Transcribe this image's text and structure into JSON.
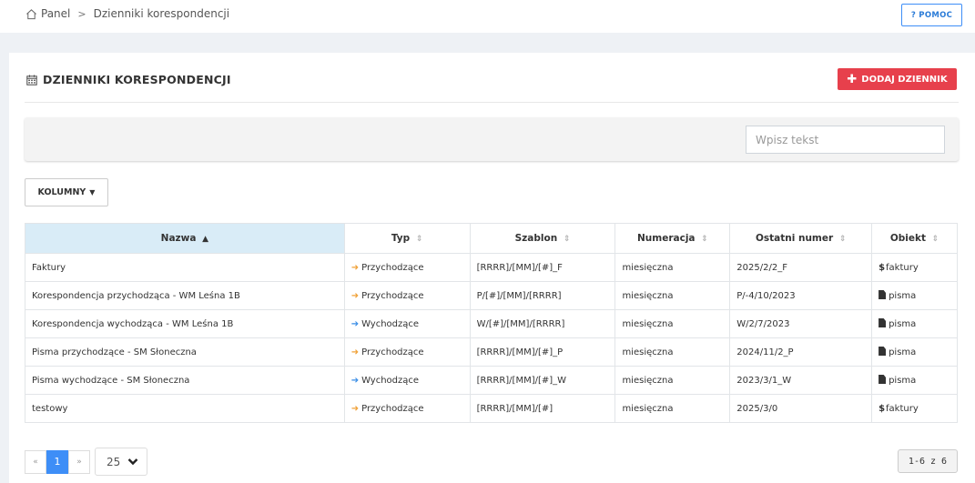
{
  "breadcrumb": {
    "home": "Panel",
    "current": "Dzienniki korespondencji"
  },
  "help_label": "? POMOC",
  "page_title": "DZIENNIKI KORESPONDENCJI",
  "add_label": "DODAJ DZIENNIK",
  "search": {
    "placeholder": "Wpisz tekst",
    "value": ""
  },
  "columns_button": "KOLUMNY",
  "table": {
    "headers": {
      "name": "Nazwa",
      "type": "Typ",
      "template": "Szablon",
      "numbering": "Numeracja",
      "last_number": "Ostatni numer",
      "object": "Obiekt"
    },
    "rows": [
      {
        "name": "Faktury",
        "type": "Przychodzące",
        "type_icon": "sign-in-icon",
        "template": "[RRRR]/[MM]/[#]_F",
        "numbering": "miesięczna",
        "last_number": "2025/2/2_F",
        "object": "faktury",
        "object_icon": "dollar-icon"
      },
      {
        "name": "Korespondencja przychodząca - WM Leśna 1B",
        "type": "Przychodzące",
        "type_icon": "sign-in-icon",
        "template": "P/[#]/[MM]/[RRRR]",
        "numbering": "miesięczna",
        "last_number": "P/-4/10/2023",
        "object": "pisma",
        "object_icon": "document-icon"
      },
      {
        "name": "Korespondencja wychodząca - WM Leśna 1B",
        "type": "Wychodzące",
        "type_icon": "sign-out-icon",
        "template": "W/[#]/[MM]/[RRRR]",
        "numbering": "miesięczna",
        "last_number": "W/2/7/2023",
        "object": "pisma",
        "object_icon": "document-icon"
      },
      {
        "name": "Pisma przychodzące - SM Słoneczna",
        "type": "Przychodzące",
        "type_icon": "sign-in-icon",
        "template": "[RRRR]/[MM]/[#]_P",
        "numbering": "miesięczna",
        "last_number": "2024/11/2_P",
        "object": "pisma",
        "object_icon": "document-icon"
      },
      {
        "name": "Pisma wychodzące - SM Słoneczna",
        "type": "Wychodzące",
        "type_icon": "sign-out-icon",
        "template": "[RRRR]/[MM]/[#]_W",
        "numbering": "miesięczna",
        "last_number": "2023/3/1_W",
        "object": "pisma",
        "object_icon": "document-icon"
      },
      {
        "name": "testowy",
        "type": "Przychodzące",
        "type_icon": "sign-in-icon",
        "template": "[RRRR]/[MM]/[#]",
        "numbering": "miesięczna",
        "last_number": "2025/3/0",
        "object": "faktury",
        "object_icon": "dollar-icon"
      }
    ]
  },
  "pagination": {
    "prev": "«",
    "current_page": "1",
    "next": "»",
    "page_size": "25",
    "summary": "1-6 z 6"
  },
  "colors": {
    "accent_blue": "#3e8ef7",
    "danger_red": "#e7404c",
    "sorted_header": "#d9ecf7",
    "incoming_icon": "#f0a23a",
    "outgoing_icon": "#3a8ee6"
  }
}
